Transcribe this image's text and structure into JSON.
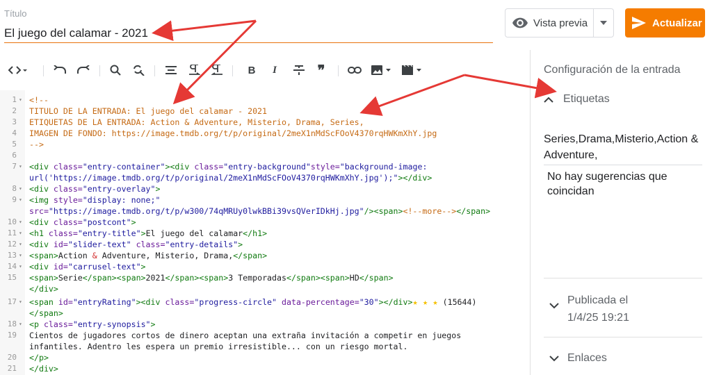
{
  "title_field": {
    "label": "Título",
    "value": "El juego del calamar - 2021"
  },
  "header": {
    "preview_label": "Vista previa",
    "update_label": "Actualizar"
  },
  "sidebar": {
    "config_title": "Configuración de la entrada",
    "labels_heading": "Etiquetas",
    "labels_value": "Series,Drama,Misterio,Action & Adventure,",
    "no_suggestions": "No hay sugerencias que coincidan",
    "published_heading": "Publicada el",
    "published_date": "1/4/25 19:21",
    "links_heading": "Enlaces"
  },
  "toolbar": {
    "icons": [
      "code-icon",
      "undo-icon",
      "redo-icon",
      "search-icon",
      "find-replace-icon",
      "align-icon",
      "ltr-icon",
      "rtl-icon",
      "bold-icon",
      "italic-icon",
      "strikethrough-icon",
      "quote-icon",
      "link-icon",
      "image-icon",
      "video-icon"
    ]
  },
  "colors": {
    "accent": "#f57c00",
    "comment": "#c56a14",
    "tag": "#107a10",
    "attr": "#6a1b9a",
    "string": "#1d1a9e",
    "arrow": "#e53935"
  },
  "code": {
    "numbers": [
      "1",
      "2",
      "3",
      "4",
      "5",
      "6",
      "7",
      "",
      "8",
      "9",
      "",
      "10",
      "11",
      "12",
      "13",
      "14",
      "15",
      "",
      "17",
      "",
      "18",
      "19",
      "",
      "20",
      "21"
    ],
    "lines": {
      "l1": "<!--",
      "l2": "TITULO DE LA ENTRADA: El juego del calamar - 2021",
      "l3": "ETIQUETAS DE LA ENTRADA: Action & Adventure, Misterio, Drama, Series,",
      "l4": "IMAGEN DE FONDO: https://image.tmdb.org/t/p/original/2meX1nMdScFOoV4370rqHWKmXhY.jpg",
      "l5": "-->",
      "l7a_tag1": "<div",
      "l7a_attr1": " class=",
      "l7a_str1": "\"entry-container\"",
      "l7a_tag2": "><div",
      "l7a_attr2": " class=",
      "l7a_str2": "\"entry-background\"",
      "l7a_attr3": "style=",
      "l7a_str3": "\"background-image:",
      "l7b_str": "url('https://image.tmdb.org/t/p/original/2meX1nMdScFOoV4370rqHWKmXhY.jpg');\"",
      "l7b_tag": "></div>",
      "l8_tag": "<div",
      "l8_attr": " class=",
      "l8_str": "\"entry-overlay\"",
      "l8_end": ">",
      "l9a_tag": "<img",
      "l9a_attr": " style=",
      "l9a_str": "\"display: none;\"",
      "l9b_attr": "src=",
      "l9b_str": "\"https://image.tmdb.org/t/p/w300/74qMRUy0lwkBBi39vsQVerIDkHj.jpg\"",
      "l9b_tag": "/><span>",
      "l9b_cm": "<!--more-->",
      "l9b_tag2": "</span>",
      "l10_tag": "<div",
      "l10_attr": " class=",
      "l10_str": "\"postcont\"",
      "l10_end": ">",
      "l11_tag": "<h1",
      "l11_attr": " class=",
      "l11_str": "\"entry-title\"",
      "l11_tag2": ">",
      "l11_text": "El juego del calamar",
      "l11_tag3": "</h1>",
      "l12_tag": "<div",
      "l12_attr": " id=",
      "l12_str": "\"slider-text\"",
      "l12_attr2": " class=",
      "l12_str2": "\"entry-details\"",
      "l12_end": ">",
      "l13_tag": "<span>",
      "l13_t1": "Action ",
      "l13_amp": "&",
      "l13_t2": " Adventure, Misterio, Drama,",
      "l13_tag2": "</span>",
      "l14_tag": "<div",
      "l14_attr": " id=",
      "l14_str": "\"carrusel-text\"",
      "l14_end": ">",
      "l15_tag1": "<span>",
      "l15_t1": "Serie",
      "l15_tag2": "</span><span>",
      "l15_t2": "2021",
      "l15_tag3": "</span><span>",
      "l15_t3": "3 Temporadas",
      "l15_tag4": "</span><span>",
      "l15_t4": "HD",
      "l15_tag5": "</span>",
      "l16": "</div>",
      "l17a_tag": "<span",
      "l17a_attr": " id=",
      "l17a_str": "\"entryRating\"",
      "l17a_tag2": "><div",
      "l17a_attr2": " class=",
      "l17a_str2": "\"progress-circle\"",
      "l17a_attr3": " data-percentage=",
      "l17a_str3": "\"30\"",
      "l17a_tag3": "></div>",
      "l17a_stars": "★ ★ ★",
      "l17a_count": " (15644)",
      "l17b": "</span>",
      "l18_tag": "<p",
      "l18_attr": " class=",
      "l18_str": "\"entry-synopsis\"",
      "l18_end": ">",
      "l19a": "Cientos de jugadores cortos de dinero aceptan una extraña invitación a competir en juegos",
      "l19b": "infantiles. Adentro les espera un premio irresistible... con un riesgo mortal.",
      "l20": "</p>",
      "l21": "</div>"
    }
  }
}
